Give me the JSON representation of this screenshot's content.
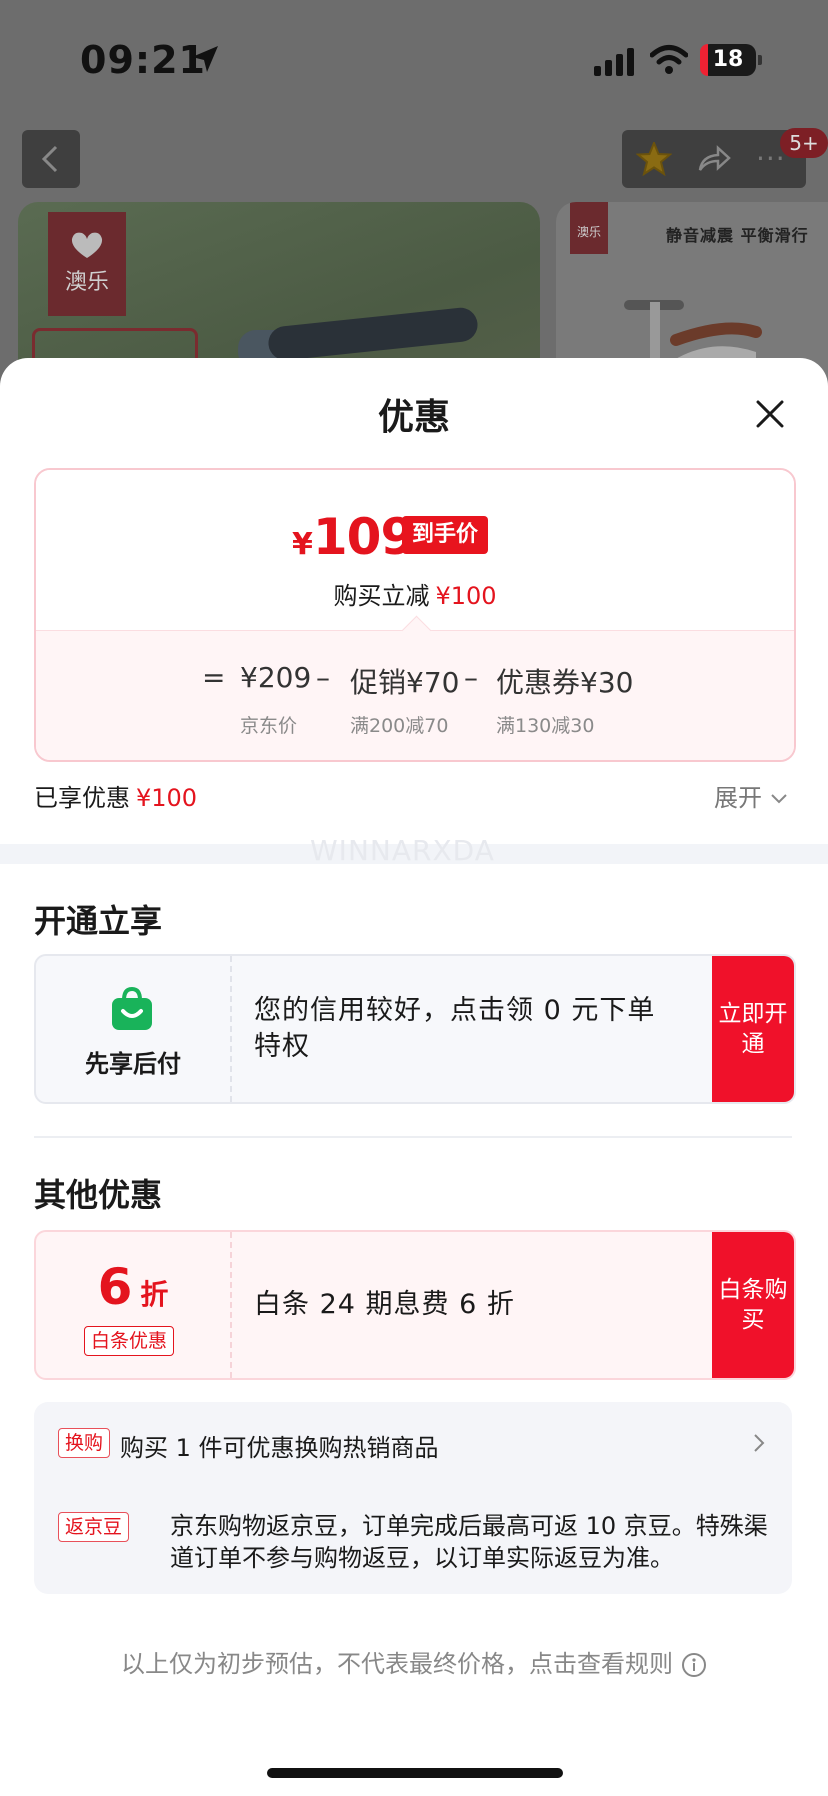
{
  "status_bar": {
    "time": "09:21",
    "battery": "18"
  },
  "background_page": {
    "badge": "5+",
    "brand_logo": "澳乐",
    "side_brand_logo": "澳乐",
    "side_image_text": "静音减震 平衡滑行"
  },
  "sheet": {
    "title": "优惠",
    "final_price": {
      "currency": "¥",
      "amount": "109",
      "tag": "到手价"
    },
    "reduce_line": {
      "label": "购买立减",
      "amount": "¥100"
    },
    "formula": {
      "equals": "=",
      "jd_price": "¥209",
      "jd_price_label": "京东价",
      "minus1": "–",
      "promo": "促销¥70",
      "promo_rule": "满200减70",
      "minus2": "–",
      "coupon": "优惠券¥30",
      "coupon_rule": "满130减30"
    },
    "enjoyed": {
      "label": "已享优惠",
      "amount": "¥100"
    },
    "expand_label": "展开",
    "watermark": "WINNARXDA",
    "open_section": {
      "title": "开通立享",
      "offer": {
        "left_label": "先享后付",
        "text": "您的信用较好，点击领 0 元下单特权",
        "button": "立即开通"
      }
    },
    "other_section": {
      "title": "其他优惠",
      "offer": {
        "discount_number": "6",
        "discount_unit": "折",
        "discount_tag": "白条优惠",
        "text": "白条 24 期息费 6 折",
        "button": "白条购买"
      }
    },
    "info": {
      "swap_tag": "换购",
      "swap_text": "购买 1 件可优惠换购热销商品",
      "bean_tag": "返京豆",
      "bean_text": "京东购物返京豆，订单完成后最高可返 10 京豆。特殊渠道订单不参与购物返豆，以订单实际返豆为准。"
    },
    "disclaimer": "以上仅为初步预估，不代表最终价格，点击查看规则"
  },
  "colors": {
    "accent_red": "#e4141e",
    "button_red": "#f0112a",
    "credit_green": "#19b35a"
  },
  "icons": {
    "back": "chevron-left-icon",
    "favorite": "star-icon",
    "share": "share-icon",
    "more": "more-icon",
    "close": "close-icon",
    "expand": "chevron-down-icon",
    "credit": "shopping-bag-icon",
    "swap_arrow": "chevron-right-icon",
    "rules": "info-icon"
  }
}
